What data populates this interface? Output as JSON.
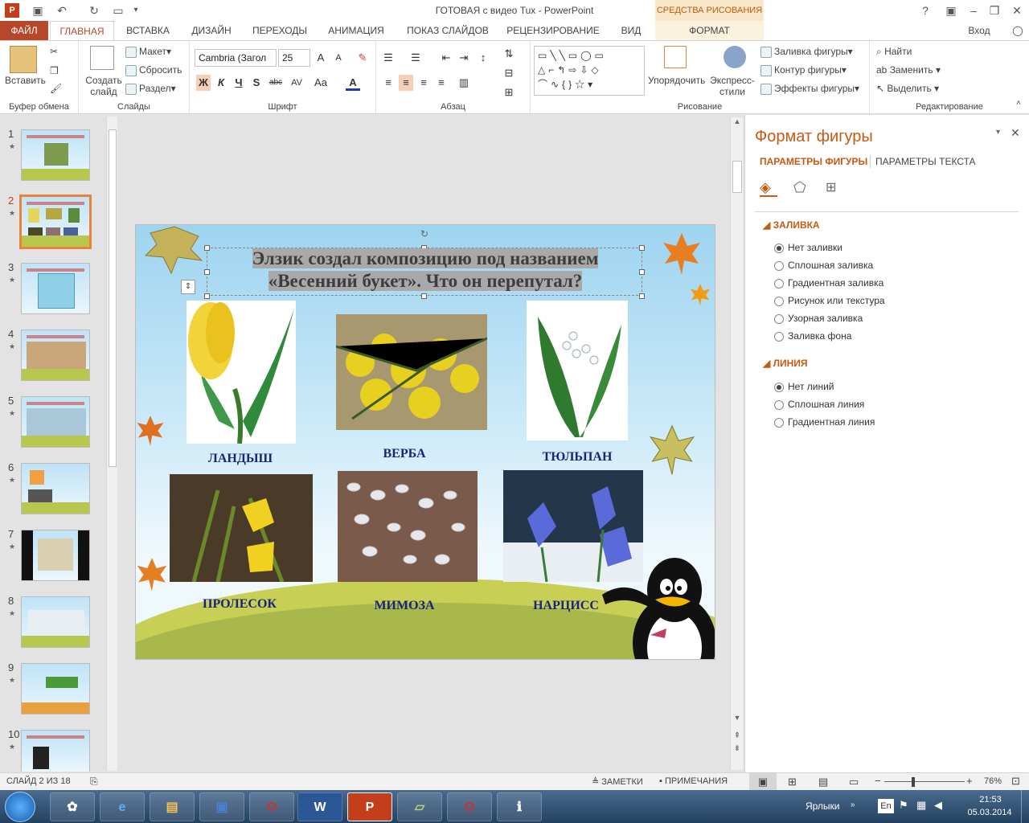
{
  "window": {
    "title": "ГОТОВАЯ с видео Tux - PowerPoint",
    "context_tools": "СРЕДСТВА РИСОВАНИЯ",
    "help": "?",
    "signin": "Вход"
  },
  "tabs": [
    "ФАЙЛ",
    "ГЛАВНАЯ",
    "ВСТАВКА",
    "ДИЗАЙН",
    "ПЕРЕХОДЫ",
    "АНИМАЦИЯ",
    "ПОКАЗ СЛАЙДОВ",
    "РЕЦЕНЗИРОВАНИЕ",
    "ВИД",
    "ФОРМАТ"
  ],
  "ribbon": {
    "clipboard": {
      "paste": "Вставить",
      "label": "Буфер обмена"
    },
    "slides": {
      "new_slide": "Создать слайд",
      "layout": "Макет",
      "reset": "Сбросить",
      "section": "Раздел",
      "label": "Слайды"
    },
    "font": {
      "name": "Cambria (Загол",
      "size": "25",
      "bold": "Ж",
      "italic": "К",
      "underline": "Ч",
      "shadow": "S",
      "strike": "abc",
      "spacing": "AV",
      "case": "Aa",
      "color": "A",
      "grow": "A",
      "shrink": "A",
      "label": "Шрифт"
    },
    "paragraph": {
      "label": "Абзац"
    },
    "drawing": {
      "arrange": "Упорядочить",
      "quick_styles": "Экспресс-стили",
      "fill": "Заливка фигуры",
      "outline": "Контур фигуры",
      "effects": "Эффекты фигуры",
      "label": "Рисование"
    },
    "editing": {
      "find": "Найти",
      "replace": "Заменить",
      "select": "Выделить",
      "label": "Редактирование"
    }
  },
  "thumbnails": [
    {
      "num": "1",
      "star": "★"
    },
    {
      "num": "2",
      "star": "★"
    },
    {
      "num": "3",
      "star": "★"
    },
    {
      "num": "4",
      "star": "★"
    },
    {
      "num": "5",
      "star": "★"
    },
    {
      "num": "6",
      "star": "★"
    },
    {
      "num": "7",
      "star": "★"
    },
    {
      "num": "8",
      "star": "★"
    },
    {
      "num": "9",
      "star": "★"
    },
    {
      "num": "10",
      "star": "★"
    }
  ],
  "slide": {
    "title_line1": "Элзик создал  композицию под названием",
    "title_line2": "«Весенний букет». Что он перепутал?",
    "captions": [
      "ЛАНДЫШ",
      "ВЕРБА",
      "ТЮЛЬПАН",
      "ПРОЛЕСОК",
      "МИМОЗА",
      "НАРЦИСС"
    ]
  },
  "format_pane": {
    "title": "Формат фигуры",
    "tab_shape": "ПАРАМЕТРЫ ФИГУРЫ",
    "tab_text": "ПАРАМЕТРЫ ТЕКСТА",
    "fill_section": "ЗАЛИВКА",
    "fill_options": [
      "Нет заливки",
      "Сплошная заливка",
      "Градиентная заливка",
      "Рисунок или текстура",
      "Узорная заливка",
      "Заливка фона"
    ],
    "line_section": "ЛИНИЯ",
    "line_options": [
      "Нет линий",
      "Сплошная линия",
      "Градиентная линия"
    ]
  },
  "status": {
    "slide_of": "СЛАЙД 2 ИЗ 18",
    "notes": "ЗАМЕТКИ",
    "comments": "ПРИМЕЧАНИЯ",
    "zoom": "76%"
  },
  "taskbar": {
    "label": "Ярлыки",
    "lang": "En",
    "time": "21:53",
    "date": "05.03.2014"
  },
  "colors": {
    "accent": "#b7472a",
    "pane_accent": "#c55a11",
    "caption": "#1a237e"
  }
}
